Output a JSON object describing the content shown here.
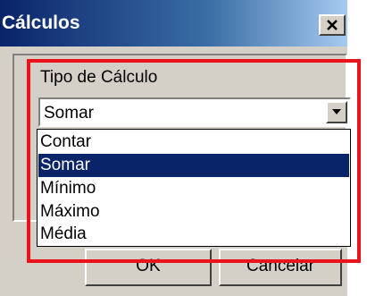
{
  "window": {
    "title": "Cálculos",
    "close_icon": "close-icon"
  },
  "group": {
    "label": "Tipo de Cálculo"
  },
  "combo": {
    "selected_value": "Somar",
    "arrow_icon": "chevron-down-icon"
  },
  "dropdown": {
    "options": [
      {
        "label": "Contar",
        "selected": false
      },
      {
        "label": "Somar",
        "selected": true
      },
      {
        "label": "Mínimo",
        "selected": false
      },
      {
        "label": "Máximo",
        "selected": false
      },
      {
        "label": "Média",
        "selected": false
      }
    ]
  },
  "buttons": {
    "ok_label": "OK",
    "cancel_label": "Cancelar"
  },
  "colors": {
    "titlebar_start": "#0a246a",
    "titlebar_end": "#a6caf0",
    "selection": "#0a246a",
    "highlight_box": "#e8131b",
    "face": "#d4d0c8"
  }
}
